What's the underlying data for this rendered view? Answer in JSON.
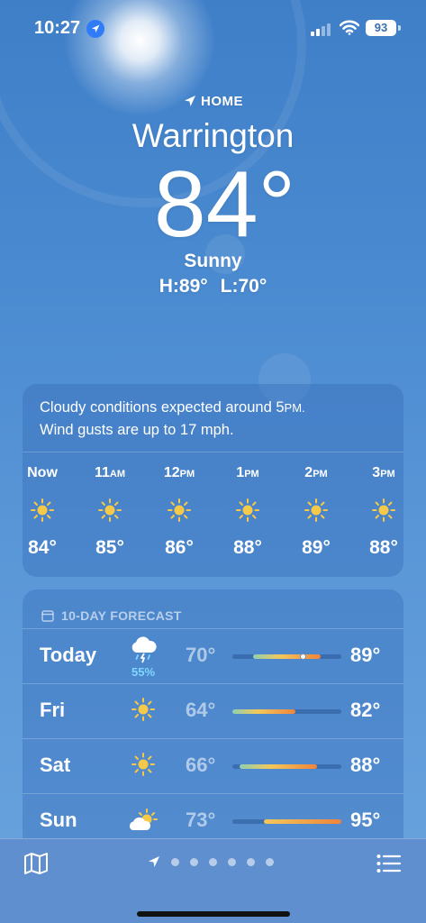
{
  "status_bar": {
    "time": "10:27",
    "battery": "93"
  },
  "hero": {
    "location_label": "HOME",
    "city": "Warrington",
    "temperature": "84°",
    "condition": "Sunny",
    "high": "H:89°",
    "low": "L:70°"
  },
  "hourly": {
    "summary_line1": "Cloudy conditions expected around 5",
    "summary_line1_suffix": "PM.",
    "summary_line2": "Wind gusts are up to 17 mph.",
    "hours": [
      {
        "label": "Now",
        "suffix": "",
        "temp": "84°",
        "icon": "sun-icon"
      },
      {
        "label": "11",
        "suffix": "AM",
        "temp": "85°",
        "icon": "sun-icon"
      },
      {
        "label": "12",
        "suffix": "PM",
        "temp": "86°",
        "icon": "sun-icon"
      },
      {
        "label": "1",
        "suffix": "PM",
        "temp": "88°",
        "icon": "sun-icon"
      },
      {
        "label": "2",
        "suffix": "PM",
        "temp": "89°",
        "icon": "sun-icon"
      },
      {
        "label": "3",
        "suffix": "PM",
        "temp": "88°",
        "icon": "sun-icon"
      }
    ]
  },
  "daily": {
    "header": "10-DAY FORECAST",
    "range_min": 64,
    "range_max": 95,
    "days": [
      {
        "name": "Today",
        "icon": "thunderstorm-icon",
        "precip": "55%",
        "low": "70°",
        "high": "89°",
        "low_val": 70,
        "high_val": 89,
        "current_val": 84
      },
      {
        "name": "Fri",
        "icon": "sun-icon",
        "precip": "",
        "low": "64°",
        "high": "82°",
        "low_val": 64,
        "high_val": 82
      },
      {
        "name": "Sat",
        "icon": "sun-icon",
        "precip": "",
        "low": "66°",
        "high": "88°",
        "low_val": 66,
        "high_val": 88
      },
      {
        "name": "Sun",
        "icon": "partly-cloudy-icon",
        "precip": "",
        "low": "73°",
        "high": "95°",
        "low_val": 73,
        "high_val": 95
      }
    ]
  },
  "colors": {
    "accent_cool": "#8fd0b0",
    "accent_warm": "#f2c85a",
    "accent_hot": "#f0843c",
    "precip": "#7fd6ff"
  },
  "bottom_bar": {
    "page_count": 6
  }
}
